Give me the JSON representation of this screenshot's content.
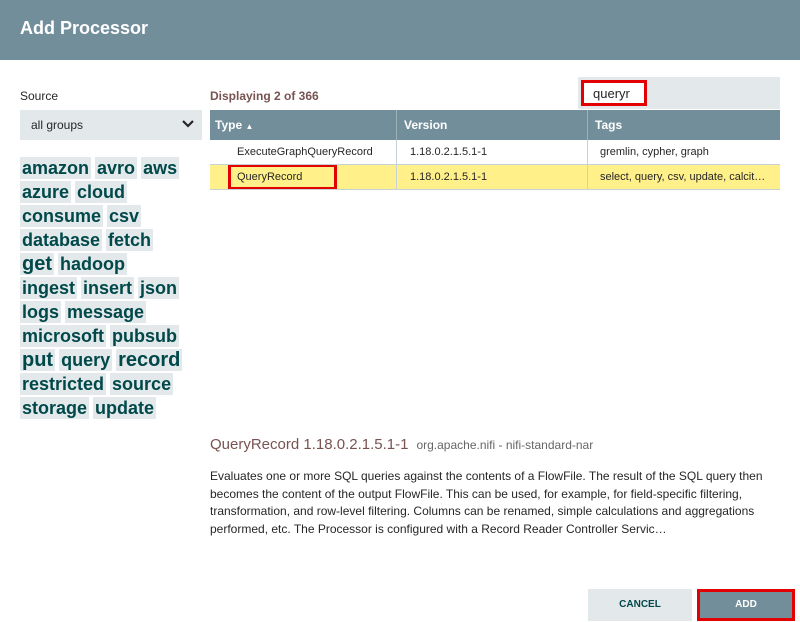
{
  "dialog": {
    "title": "Add Processor"
  },
  "source": {
    "label": "Source",
    "selected": "all groups"
  },
  "tag_rows": [
    [
      "amazon",
      "avro",
      "aws"
    ],
    [
      "azure",
      "cloud"
    ],
    [
      "consume",
      "csv"
    ],
    [
      "database",
      "fetch"
    ],
    [
      "get",
      "hadoop"
    ],
    [
      "ingest",
      "insert",
      "json"
    ],
    [
      "logs",
      "message"
    ],
    [
      "microsoft",
      "pubsub"
    ],
    [
      "put",
      "query",
      "record"
    ],
    [
      "restricted",
      "source"
    ],
    [
      "storage",
      "update"
    ]
  ],
  "filter": {
    "value": "queryr"
  },
  "list": {
    "displaying": "Displaying 2 of 366",
    "columns": {
      "type": "Type",
      "sort_indicator": "▲",
      "version": "Version",
      "tags": "Tags"
    },
    "rows": [
      {
        "type": "ExecuteGraphQueryRecord",
        "version": "1.18.0.2.1.5.1-1",
        "tags": "gremlin, cypher, graph"
      },
      {
        "type": "QueryRecord",
        "version": "1.18.0.2.1.5.1-1",
        "tags": "select, query, csv, update, calcit…"
      }
    ],
    "selected_index": 1
  },
  "details": {
    "title": "QueryRecord 1.18.0.2.1.5.1-1",
    "bundle": "org.apache.nifi - nifi-standard-nar",
    "description": "Evaluates one or more SQL queries against the contents of a FlowFile. The result of the SQL query then becomes the content of the output FlowFile. This can be used, for example, for field-specific filtering, transformation, and row-level filtering. Columns can be renamed, simple calculations and aggregations performed, etc. The Processor is configured with a Record Reader Controller Servic…"
  },
  "buttons": {
    "cancel": "CANCEL",
    "add": "ADD"
  },
  "colors": {
    "header": "#728e9b",
    "selected_row": "#fff08a",
    "highlight": "#e30000",
    "tag_text": "#004849"
  },
  "icons": {
    "dropdown": "chevron-down-icon"
  }
}
